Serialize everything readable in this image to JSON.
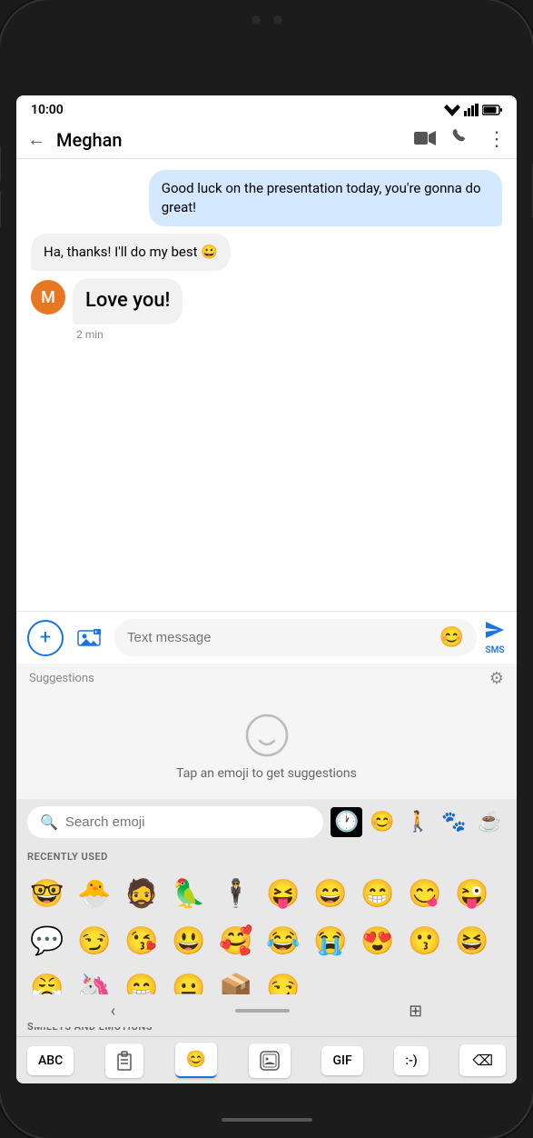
{
  "phone": {
    "status_time": "10:00"
  },
  "app_bar": {
    "title": "Meghan",
    "back_label": "←"
  },
  "messages": [
    {
      "id": "msg1",
      "type": "sent",
      "text": "Good luck on the presentation today, you're gonna do great!"
    },
    {
      "id": "msg2",
      "type": "received_single",
      "text": "Ha, thanks! I'll do my best 😀"
    },
    {
      "id": "msg3",
      "type": "received_group",
      "avatar_letter": "M",
      "messages": [
        {
          "text": "Love you!"
        },
        {
          "text": "2 min",
          "is_time": true
        }
      ]
    }
  ],
  "input": {
    "placeholder": "Text message",
    "send_label": "SMS"
  },
  "suggestions": {
    "label": "Suggestions",
    "hint": "Tap an emoji to get suggestions"
  },
  "emoji_keyboard": {
    "search_placeholder": "Search emoji",
    "recently_used_label": "RECENTLY USED",
    "smileys_label": "SMILEYS AND EMOTIONS",
    "emojis_row1": [
      "🤓",
      "🐣",
      "🧔",
      "🦜",
      "🕴",
      "😝",
      "😄",
      "😁",
      "😋"
    ],
    "emojis_row2": [
      "😜",
      "💬",
      "😏",
      "😘",
      "😃",
      "🥰",
      "😂",
      "😭",
      ""
    ],
    "emojis_row3": [
      "😍",
      "😗",
      "😆",
      "😤",
      "🦄",
      "😁",
      "😐",
      "📦",
      "😏"
    ],
    "categories": [
      "🕐",
      "😊",
      "🧍",
      "🐾",
      "☕"
    ],
    "bottom_keys": [
      "ABC",
      "📋",
      "😊",
      "🖼",
      "GIF",
      ":-)",
      "⌫"
    ]
  }
}
